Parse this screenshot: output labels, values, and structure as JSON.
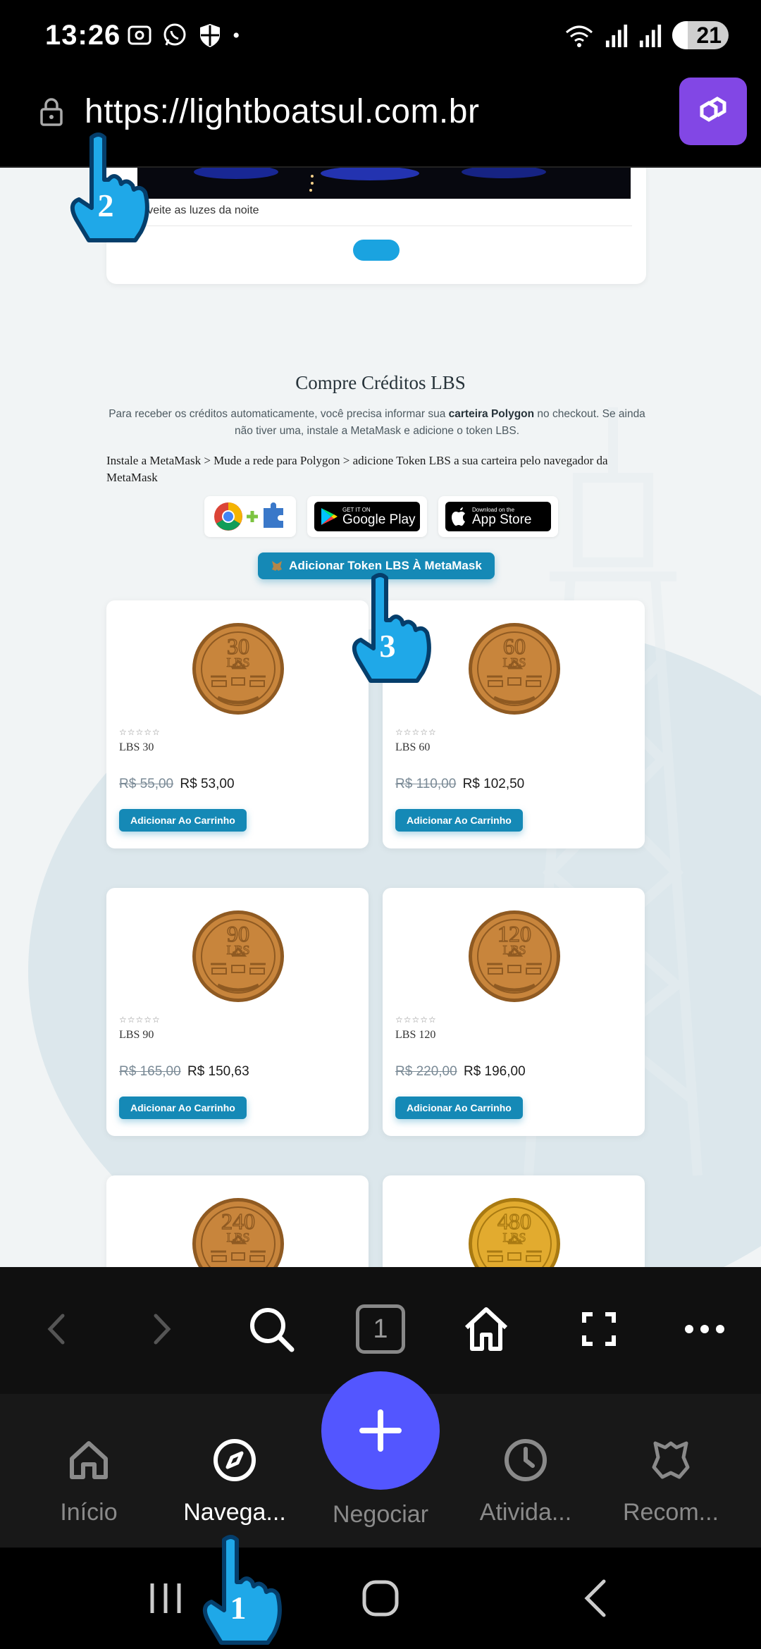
{
  "status_bar": {
    "time": "13:26",
    "battery": "21"
  },
  "browser": {
    "url": "https://lightboatsul.com.br"
  },
  "page": {
    "top_card_caption": "roveite as luzes da noite",
    "section_title": "Compre Créditos LBS",
    "description_part1": "Para receber os créditos automaticamente, você precisa informar sua ",
    "description_bold": "carteira Polygon",
    "description_part2": " no checkout. Se ainda não tiver uma, instale a MetaMask e adicione o token LBS.",
    "steps": "Instale a MetaMask > Mude a rede para Polygon > adicione Token LBS a sua carteira pelo navegador da MetaMask",
    "google_play_small": "GET IT ON",
    "google_play_big": "Google Play",
    "app_store_small": "Download on the",
    "app_store_big": "App Store",
    "add_token_button": "Adicionar Token LBS À MetaMask",
    "products": [
      {
        "name": "LBS 30",
        "coin_top": "30",
        "coin_mid": "LBS",
        "old_price": "R$ 55,00",
        "price": "R$ 53,00",
        "button": "Adicionar Ao Carrinho",
        "stars": "☆☆☆☆☆"
      },
      {
        "name": "LBS 60",
        "coin_top": "60",
        "coin_mid": "LBS",
        "old_price": "R$ 110,00",
        "price": "R$ 102,50",
        "button": "Adicionar Ao Carrinho",
        "stars": "☆☆☆☆☆"
      },
      {
        "name": "LBS 90",
        "coin_top": "90",
        "coin_mid": "LBS",
        "old_price": "R$ 165,00",
        "price": "R$ 150,63",
        "button": "Adicionar Ao Carrinho",
        "stars": "☆☆☆☆☆"
      },
      {
        "name": "LBS 120",
        "coin_top": "120",
        "coin_mid": "LBS",
        "old_price": "R$ 220,00",
        "price": "R$ 196,00",
        "button": "Adicionar Ao Carrinho",
        "stars": "☆☆☆☆☆"
      },
      {
        "coin_top": "240",
        "coin_mid": "LBS"
      },
      {
        "coin_top": "480",
        "coin_mid": "LBS"
      }
    ]
  },
  "toolbar": {
    "tab_count": "1",
    "icons": [
      "back-icon",
      "forward-icon",
      "search-icon",
      "tabs-icon",
      "home-icon",
      "fullscreen-icon",
      "more-icon"
    ]
  },
  "app_nav": {
    "items": [
      {
        "label": "Início",
        "icon": "home-icon"
      },
      {
        "label": "Navega...",
        "icon": "compass-icon",
        "active": true
      },
      {
        "label": "Negociar",
        "icon": "plus-icon"
      },
      {
        "label": "Ativida...",
        "icon": "clock-icon"
      },
      {
        "label": "Recom...",
        "icon": "reward-icon"
      }
    ]
  },
  "tutorial_markers": [
    "1",
    "2",
    "3"
  ],
  "colors": {
    "accent": "#1589b6",
    "fab": "#5356ff",
    "polygon": "#8247e5",
    "coin_bronze": "#c8853c",
    "coin_gold": "#e2ab2f"
  }
}
